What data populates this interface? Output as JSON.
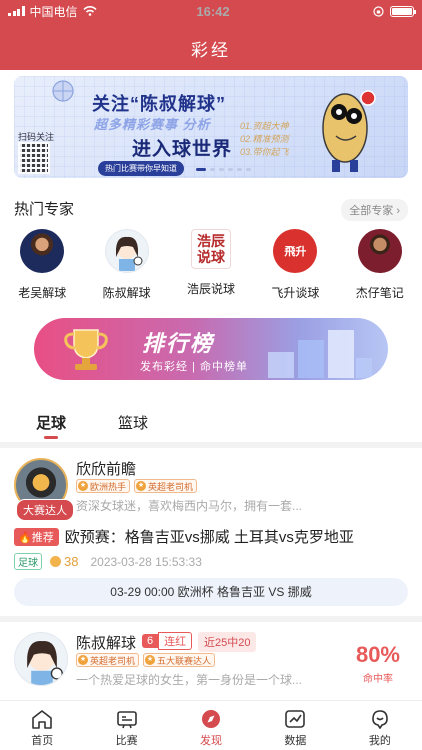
{
  "status": {
    "carrier": "中国电信",
    "time": "16:42"
  },
  "header": {
    "title": "彩经"
  },
  "banner": {
    "headline": "关注“陈叔解球”",
    "subline": "超多精彩赛事 分析",
    "mainline": "进入球世界",
    "list": [
      "01.资超大神",
      "02.精准预测",
      "03.带你起飞"
    ],
    "scan_label": "扫码关注",
    "pill": "热门比赛带你早知道"
  },
  "experts_section": {
    "title": "热门专家",
    "all_label": "全部专家",
    "items": [
      {
        "name": "老吴解球",
        "avatar_text": ""
      },
      {
        "name": "陈叔解球",
        "avatar_text": ""
      },
      {
        "name": "浩辰说球",
        "avatar_text": "浩辰说球"
      },
      {
        "name": "飞升谈球",
        "avatar_text": "飛升"
      },
      {
        "name": "杰仔笔记",
        "avatar_text": ""
      }
    ]
  },
  "ranking": {
    "title": "排行榜",
    "subtitle": "发布彩经 | 命中榜单"
  },
  "tabs": {
    "football": "足球",
    "basketball": "篮球"
  },
  "card1": {
    "name": "欣欣前瞻",
    "badge": "大赛达人",
    "tags": [
      "欧洲热手",
      "英超老司机"
    ],
    "desc": "资深女球迷，喜欢梅西内马尔，拥有一套...",
    "rec_tag": "推荐",
    "rec_title": "欧预赛：格鲁吉亚vs挪威  土耳其vs克罗地亚",
    "sport": "足球",
    "coins": "38",
    "time": "2023-03-28 15:53:33",
    "match": "03-29 00:00 欧洲杯 格鲁吉亚 VS 挪威"
  },
  "card2": {
    "name": "陈叔解球",
    "streak_n": "6",
    "streak_label": "连红",
    "recent": "近25中20",
    "tags": [
      "英超老司机",
      "五大联赛达人"
    ],
    "desc": "一个热爱足球的女生，第一身份是一个球...",
    "hit_rate": "80%",
    "hit_label": "命中率"
  },
  "nav": [
    {
      "label": "首页",
      "icon": "home-icon"
    },
    {
      "label": "比赛",
      "icon": "match-icon"
    },
    {
      "label": "发现",
      "icon": "discover-icon",
      "active": true
    },
    {
      "label": "数据",
      "icon": "data-icon"
    },
    {
      "label": "我的",
      "icon": "profile-icon"
    }
  ],
  "colors": {
    "brand": "#d44a4e",
    "accent": "#e85a5a"
  }
}
